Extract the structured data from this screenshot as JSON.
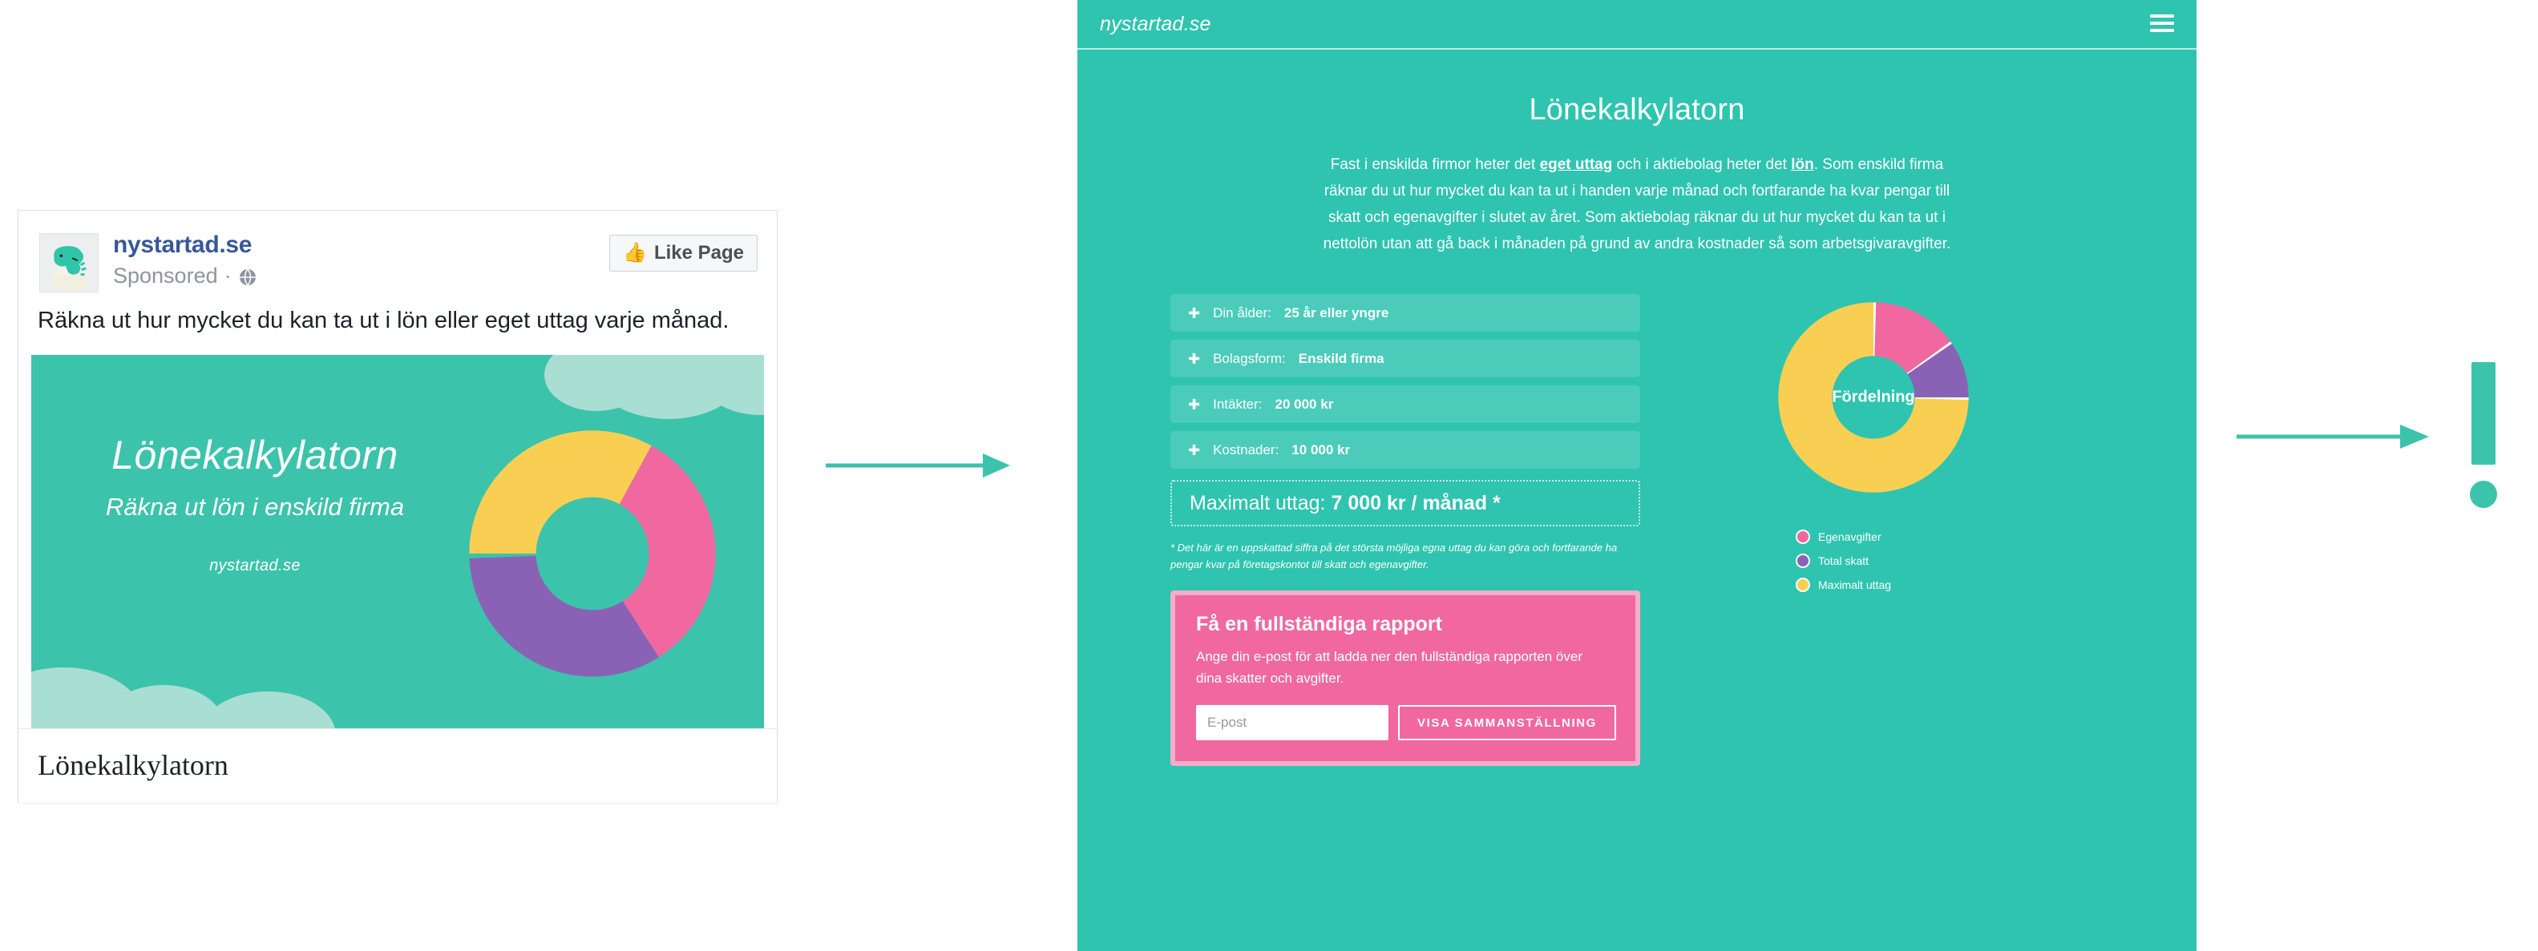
{
  "facebook_ad": {
    "page_name": "nystartad.se",
    "sponsored_label": "Sponsored",
    "separator": "·",
    "globe_icon": "globe-icon",
    "like_button": {
      "label": "Like Page",
      "icon": "thumbs-up-icon"
    },
    "body_text": "Räkna ut hur mycket du kan ta ut i lön eller eget uttag varje månad.",
    "creative": {
      "headline": "Lönekalkylatorn",
      "subhead": "Räkna ut lön i enskild firma",
      "url": "nystartad.se",
      "background_color": "#3cc3ab",
      "cloud_color": "#a9ded3"
    },
    "caption": "Lönekalkylatorn"
  },
  "annotations": {
    "arrow_1": "arrow-right-icon",
    "arrow_2": "arrow-right-icon",
    "exclamation": "exclamation-mark-icon",
    "accent_color": "#3cc3ab"
  },
  "site": {
    "header": {
      "logo": "nystartad.se",
      "menu_icon": "hamburger-menu-icon"
    },
    "title": "Lönekalkylatorn",
    "intro": {
      "part1": "Fast i enskilda firmor heter det ",
      "link1": "eget uttag",
      "part2": " och i aktiebolag heter det ",
      "link2": "lön",
      "part3": ". Som enskild firma räknar du ut hur mycket du kan ta ut i handen varje månad och fortfarande ha kvar pengar till skatt och egenavgifter i slutet av året. Som aktiebolag räknar du ut hur mycket du kan ta ut i nettolön utan att gå back i månaden på grund av andra kostnader så som arbetsgivaravgifter."
    },
    "form_rows": [
      {
        "icon": "plus-icon",
        "label": "Din ålder:",
        "value": "25 år eller yngre"
      },
      {
        "icon": "plus-icon",
        "label": "Bolagsform:",
        "value": "Enskild firma"
      },
      {
        "icon": "plus-icon",
        "label": "Intäkter:",
        "value": "20 000 kr"
      },
      {
        "icon": "plus-icon",
        "label": "Kostnader:",
        "value": "10 000 kr"
      }
    ],
    "result": {
      "label": "Maximalt uttag:",
      "value": "7 000 kr / månad *"
    },
    "footnote": "* Det här är en uppskattad siffra på det största möjliga egna uttag du kan göra och fortfarande ha pengar kvar på företagskontot till skatt och egenavgifter.",
    "lead_box": {
      "title": "Få en fullständiga rapport",
      "description": "Ange din e-post för att ladda ner den fullständiga rapporten över dina skatter och avgifter.",
      "email_placeholder": "E-post",
      "email_value": "",
      "submit_label": "VISA SAMMANSTÄLLNING",
      "background_color": "#f0689f"
    }
  },
  "chart_data": {
    "type": "pie",
    "title": "Fördelning",
    "center_label": "Fördelning",
    "categories": [
      "Egenavgifter",
      "Total skatt",
      "Maximalt uttag"
    ],
    "values": [
      15,
      10,
      75
    ],
    "unit": "%",
    "colors": [
      "#f0689f",
      "#8a62b5",
      "#f8cf53"
    ],
    "donut": true,
    "legend": "bottom-left",
    "legend_entries": [
      {
        "label": "Egenavgifter",
        "color": "#f0689f"
      },
      {
        "label": "Total skatt",
        "color": "#8a62b5"
      },
      {
        "label": "Maximalt uttag",
        "color": "#f8cf53"
      }
    ]
  },
  "ad_chart_data": {
    "type": "pie",
    "categories": [
      "Maximalt uttag",
      "Egenavgifter",
      "Total skatt"
    ],
    "values": [
      33,
      33,
      34
    ],
    "unit": "%",
    "colors": [
      "#f8cf53",
      "#f0689f",
      "#8a62b5"
    ],
    "donut": true
  }
}
